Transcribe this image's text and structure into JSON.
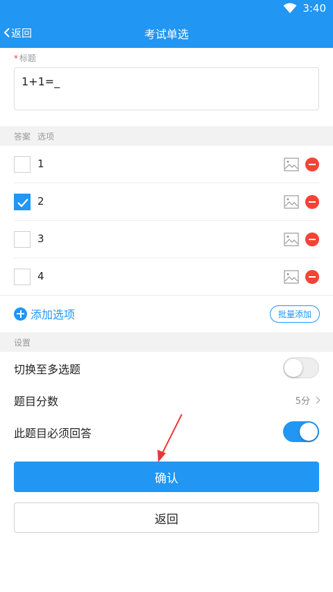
{
  "status_bar": {
    "time": "3:40"
  },
  "app_bar": {
    "back_label": "返回",
    "title": "考试单选"
  },
  "question": {
    "required_mark": "*",
    "label": "标题",
    "value": "1+1=_"
  },
  "answer_section": {
    "answer_header": "答案",
    "option_header": "选项"
  },
  "options": [
    {
      "text": "1",
      "checked": false
    },
    {
      "text": "2",
      "checked": true
    },
    {
      "text": "3",
      "checked": false
    },
    {
      "text": "4",
      "checked": false
    }
  ],
  "add_option_label": "添加选项",
  "batch_add_label": "批量添加",
  "settings": {
    "header": "设置",
    "multi_switch_label": "切换至多选题",
    "multi_switch_on": false,
    "score_label": "题目分数",
    "score_value": "5分",
    "required_label": "此题目必须回答",
    "required_on": true
  },
  "buttons": {
    "confirm": "确认",
    "back": "返回"
  },
  "colors": {
    "primary": "#2196f3",
    "danger": "#f44336",
    "annotation": "#e53935"
  }
}
